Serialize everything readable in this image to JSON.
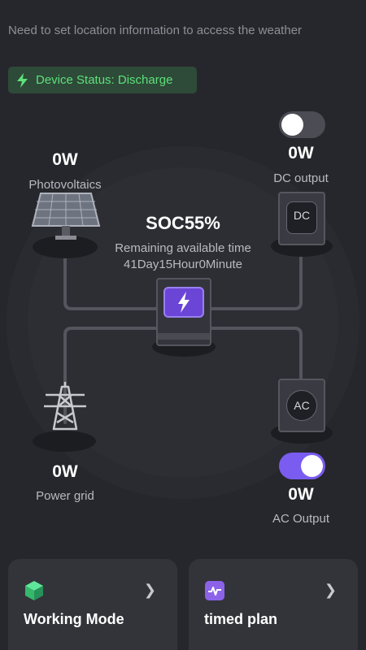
{
  "location_message": "Need to set location information to access the weather",
  "device_status": "Device Status: Discharge",
  "photovoltaics": {
    "power": "0W",
    "label": "Photovoltaics"
  },
  "dc_output": {
    "power": "0W",
    "label": "DC output",
    "enabled": false,
    "screen_label": "DC"
  },
  "battery": {
    "soc": "SOC55%",
    "remaining_label": "Remaining available time",
    "remaining_value": "41Day15Hour0Minute"
  },
  "power_grid": {
    "power": "0W",
    "label": "Power grid"
  },
  "ac_output": {
    "power": "0W",
    "label": "AC Output",
    "enabled": true,
    "screen_label": "AC"
  },
  "cards": {
    "working_mode": "Working Mode",
    "timed_plan": "timed plan"
  },
  "colors": {
    "accent": "#7a5cf0",
    "status_green": "#5ee07a",
    "background": "#26272c"
  }
}
